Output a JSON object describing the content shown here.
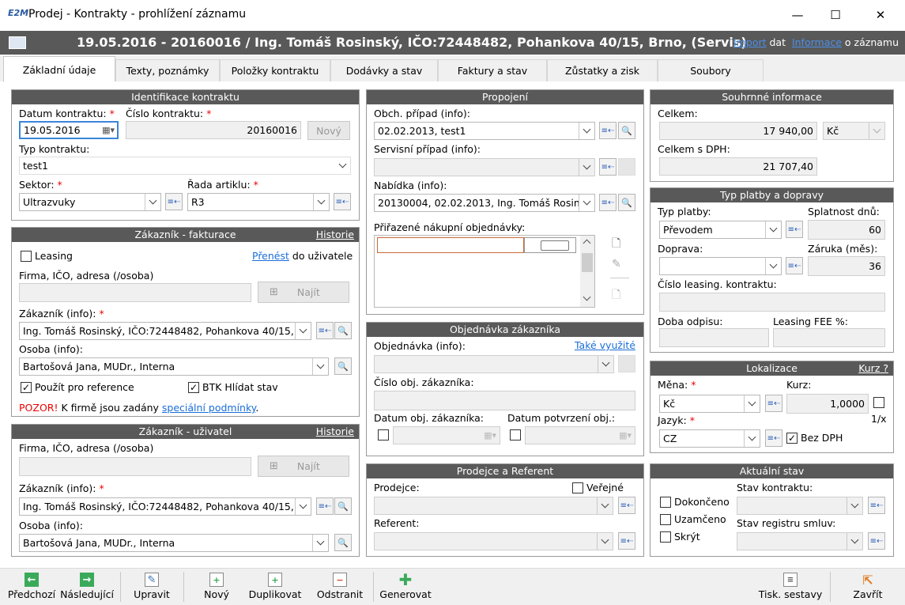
{
  "window": {
    "logo": "E2M",
    "title": "Prodej - Kontrakty - prohlížení záznamu",
    "minimize": "—",
    "maximize": "☐",
    "close": "✕"
  },
  "header": {
    "title": "19.05.2016 - 20160016 / Ing. Tomáš Rosinský, IČO:72448482, Pohankova 40/15, Brno, (Servis)",
    "import_link": "Import",
    "import_suffix": " dat",
    "info_link": "Informace",
    "info_suffix": " o záznamu"
  },
  "tabs": [
    {
      "label": "Základní údaje"
    },
    {
      "label": "Texty, poznámky"
    },
    {
      "label": "Položky kontraktu"
    },
    {
      "label": "Dodávky a stav"
    },
    {
      "label": "Faktury a stav"
    },
    {
      "label": "Zůstatky a zisk"
    },
    {
      "label": "Soubory"
    }
  ],
  "identification": {
    "title": "Identifikace kontraktu",
    "date_label": "Datum kontraktu:",
    "date_value": "19.05.2016",
    "number_label": "Číslo kontraktu:",
    "number_value": "20160016",
    "new_button": "Nový",
    "type_label": "Typ kontraktu:",
    "type_value": "test1",
    "sector_label": "Sektor:",
    "sector_value": "Ultrazvuky",
    "series_label": "Řada artiklu:",
    "series_value": "R3"
  },
  "customer_billing": {
    "title": "Zákazník - fakturace",
    "history_link": "Historie",
    "leasing_label": "Leasing",
    "transfer_link": "Přenést",
    "transfer_suffix": " do uživatele",
    "company_label": "Firma, IČO, adresa (/osoba)",
    "find_button": "Najít",
    "customer_label": "Zákazník (info):",
    "customer_value": "Ing. Tomáš Rosinský, IČO:72448482, Pohankova 40/15,",
    "person_label": "Osoba (info):",
    "person_value": "Bartošová Jana, MUDr., Interna",
    "use_reference_label": "Použít pro reference",
    "btk_label": "BTK Hlídat stav",
    "warning_prefix": "POZOR!",
    "warning_text": " K firmě jsou zadány ",
    "warning_link": "speciální podmínky",
    "warning_suffix": "."
  },
  "customer_user": {
    "title": "Zákazník - uživatel",
    "history_link": "Historie",
    "company_label": "Firma, IČO, adresa (/osoba)",
    "find_button": "Najít",
    "customer_label": "Zákazník (info):",
    "customer_value": "Ing. Tomáš Rosinský, IČO:72448482, Pohankova 40/15,",
    "person_label": "Osoba (info):",
    "person_value": "Bartošová Jana, MUDr., Interna"
  },
  "links": {
    "title": "Propojení",
    "case_label": "Obch. případ (info):",
    "case_value": "02.02.2013, test1",
    "service_label": "Servisní případ (info):",
    "offer_label": "Nabídka (info):",
    "offer_value": "20130004, 02.02.2013, Ing. Tomáš Rosin",
    "orders_label": "Přiřazené nákupní objednávky:"
  },
  "customer_order": {
    "title": "Objednávka zákazníka",
    "also_used_link": "Také využité",
    "order_label": "Objednávka (info):",
    "number_label": "Číslo obj. zákazníka:",
    "date_label": "Datum obj. zákazníka:",
    "confirm_label": "Datum potvrzení obj.:"
  },
  "sales": {
    "title": "Prodejce a Referent",
    "seller_label": "Prodejce:",
    "public_label": "Veřejné",
    "referent_label": "Referent:"
  },
  "summary": {
    "title": "Souhrnné informace",
    "total_label": "Celkem:",
    "total_value": "17 940,00",
    "currency": "Kč",
    "total_vat_label": "Celkem s DPH:",
    "total_vat_value": "21 707,40"
  },
  "payment": {
    "title": "Typ platby a dopravy",
    "type_label": "Typ platby:",
    "type_value": "Převodem",
    "due_label": "Splatnost dnů:",
    "due_value": "60",
    "transport_label": "Doprava:",
    "warranty_label": "Záruka (měs):",
    "warranty_value": "36",
    "leasing_no_label": "Číslo leasing. kontraktu:",
    "depreciation_label": "Doba odpisu:",
    "leasing_fee_label": "Leasing FEE %:"
  },
  "localization": {
    "title": "Lokalizace",
    "rate_link": "Kurz ?",
    "currency_label": "Měna:",
    "currency_value": "Kč",
    "rate_label": "Kurz:",
    "rate_value": "1,0000",
    "inverse_label": "1/x",
    "language_label": "Jazyk:",
    "language_value": "CZ",
    "no_vat_label": "Bez DPH"
  },
  "status": {
    "title": "Aktuální stav",
    "done_label": "Dokončeno",
    "locked_label": "Uzamčeno",
    "hide_label": "Skrýt",
    "contract_state_label": "Stav kontraktu:",
    "registry_state_label": "Stav registru smluv:"
  },
  "toolbar": {
    "prev": "Předchozí",
    "next": "Následující",
    "edit": "Upravit",
    "new": "Nový",
    "duplicate": "Duplikovat",
    "delete": "Odstranit",
    "generate": "Generovat",
    "print": "Tisk. sestavy",
    "close": "Zavřít"
  },
  "colors": {
    "header_bg": "#595959",
    "link": "#1a6ed8",
    "required": "#e00000",
    "nav_green": "#3aaa5a"
  }
}
